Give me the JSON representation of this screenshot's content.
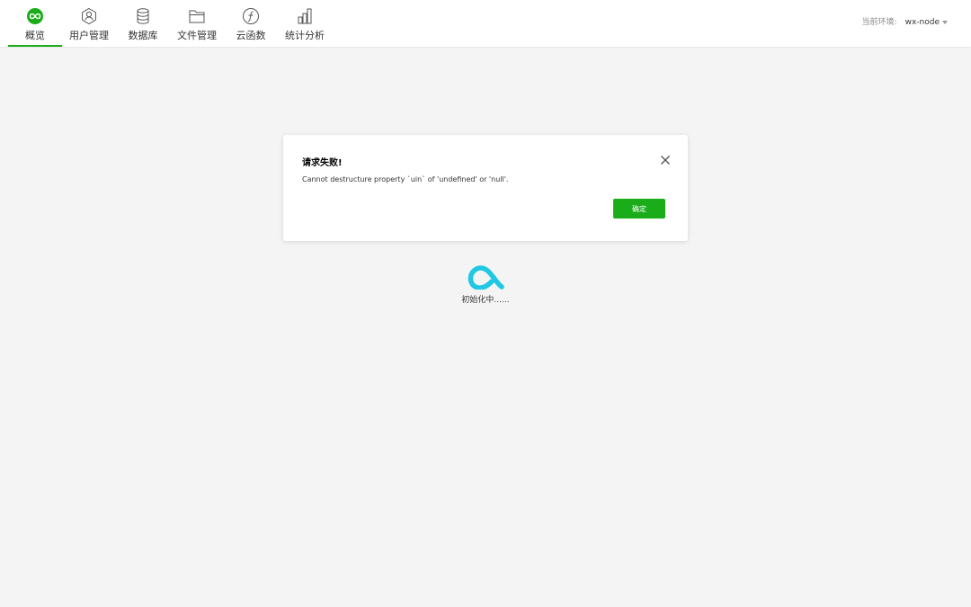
{
  "nav": {
    "items": [
      {
        "label": "概览",
        "icon": "overview-infinity-icon",
        "active": true
      },
      {
        "label": "用户管理",
        "icon": "user-management-icon"
      },
      {
        "label": "数据库",
        "icon": "database-icon"
      },
      {
        "label": "文件管理",
        "icon": "folder-icon"
      },
      {
        "label": "云函数",
        "icon": "cloud-function-icon"
      },
      {
        "label": "统计分析",
        "icon": "statistics-icon"
      }
    ]
  },
  "env": {
    "label": "当前环境:",
    "value": "wx-node"
  },
  "dialog": {
    "title": "请求失败!",
    "message": "Cannot destructure property `uin` of 'undefined' or 'null'.",
    "confirm_label": "确定"
  },
  "loading": {
    "text": "初始化中......"
  },
  "colors": {
    "accent": "#1aad19",
    "loader": "#1fc8e3",
    "background": "#f4f4f4"
  }
}
